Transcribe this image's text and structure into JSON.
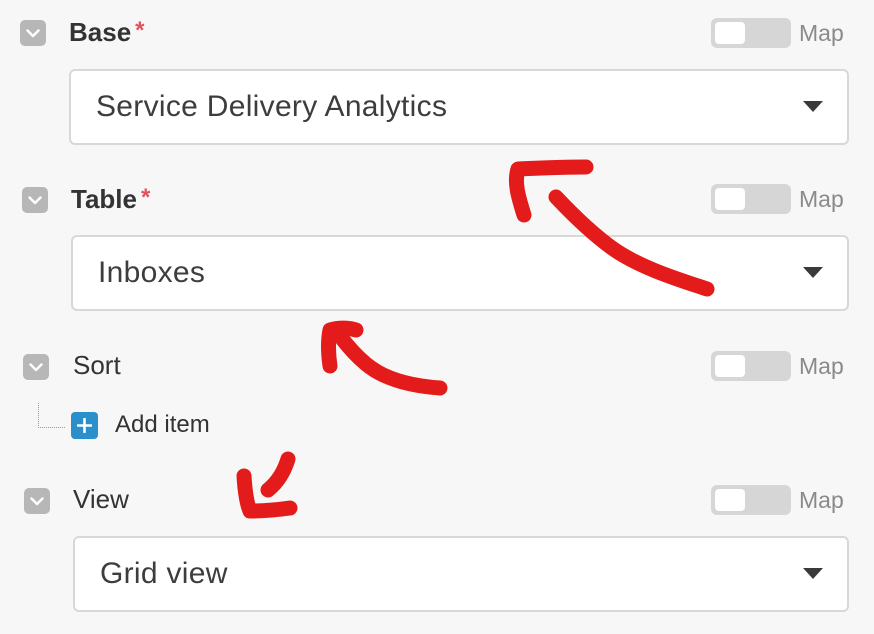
{
  "fields": [
    {
      "id": "base",
      "label": "Base",
      "required": true,
      "bold": true,
      "toggle_label": "Map",
      "toggle_on": false,
      "value": "Service Delivery Analytics"
    },
    {
      "id": "table",
      "label": "Table",
      "required": true,
      "bold": true,
      "toggle_label": "Map",
      "toggle_on": false,
      "value": "Inboxes"
    },
    {
      "id": "sort",
      "label": "Sort",
      "required": false,
      "bold": false,
      "toggle_label": "Map",
      "toggle_on": false,
      "add_item_label": "Add item"
    },
    {
      "id": "view",
      "label": "View",
      "required": false,
      "bold": false,
      "toggle_label": "Map",
      "toggle_on": false,
      "value": "Grid view"
    }
  ],
  "required_marker": "*",
  "icons": {
    "collapse": "chevron-down-icon",
    "dropdown": "caret-down-icon",
    "add": "plus-icon"
  },
  "colors": {
    "background": "#f7f7f7",
    "required": "#e2525c",
    "add_button": "#2b8fcc",
    "annotation": "#e31b1b",
    "toggle_off": "#d6d6d6"
  }
}
